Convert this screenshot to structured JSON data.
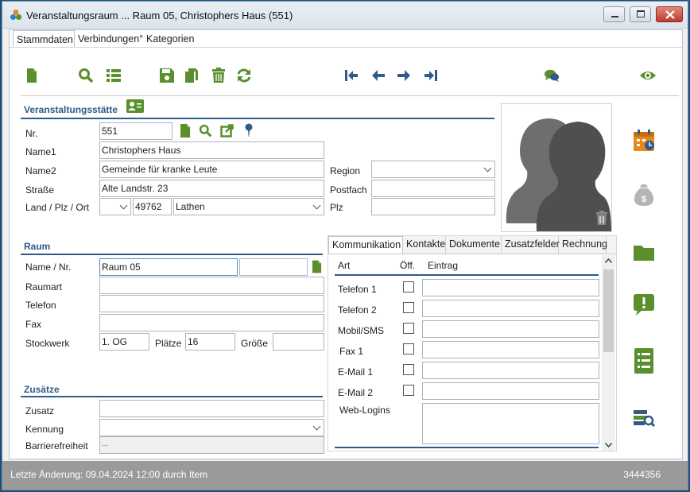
{
  "window": {
    "title": "Veranstaltungsraum ... Raum 05, Christophers Haus (551)"
  },
  "top_tabs": [
    "Stammdaten",
    "Verbindungen°",
    "Kategorien"
  ],
  "toolbar_icons": [
    "new-document-icon",
    "search-icon",
    "list-icon",
    "save-icon",
    "copy-icon",
    "delete-icon",
    "refresh-icon",
    "first-icon",
    "previous-icon",
    "next-icon",
    "last-icon",
    "chat-icon",
    "view-icon"
  ],
  "venue": {
    "section_title": "Veranstaltungsstätte",
    "nr_label": "Nr.",
    "nr_value": "551",
    "name1_label": "Name1",
    "name1_value": "Christophers Haus",
    "name2_label": "Name2",
    "name2_value": "Gemeinde für kranke Leute",
    "street_label": "Straße",
    "street_value": "Alte Landstr. 23",
    "country_label": "Land / Plz / Ort",
    "country_value": "",
    "zip_value": "49762",
    "city_value": "Lathen",
    "region_label": "Region",
    "region_value": "",
    "postfach_label": "Postfach",
    "postfach_value": "",
    "plz_label": "Plz",
    "plz_value": ""
  },
  "room": {
    "section_title": "Raum",
    "name_label": "Name / Nr.",
    "name_value": "Raum 05",
    "nr_value": "",
    "type_label": "Raumart",
    "type_value": "",
    "phone_label": "Telefon",
    "phone_value": "",
    "fax_label": "Fax",
    "fax_value": "",
    "floor_label": "Stockwerk",
    "floor_value": "1. OG",
    "seats_label": "Plätze",
    "seats_value": "16",
    "size_label": "Größe",
    "size_value": ""
  },
  "extras": {
    "section_title": "Zusätze",
    "zusatz_label": "Zusatz",
    "zusatz_value": "",
    "kennung_label": "Kennung",
    "kennung_value": "",
    "barrier_label": "Barrierefreiheit",
    "barrier_value": "..."
  },
  "comm": {
    "tabs": [
      "Kommunikation",
      "Kontakte",
      "Dokumente",
      "Zusatzfelder",
      "Rechnung"
    ],
    "col_art": "Art",
    "col_off": "Öff.",
    "col_entry": "Eintrag",
    "rows": [
      {
        "label": "Telefon 1",
        "value": ""
      },
      {
        "label": "Telefon 2",
        "value": ""
      },
      {
        "label": "Mobil/SMS",
        "value": ""
      },
      {
        "label": "Fax 1",
        "value": ""
      },
      {
        "label": "E-Mail 1",
        "value": ""
      },
      {
        "label": "E-Mail 2",
        "value": ""
      }
    ],
    "weblogins_label": "Web-Logins",
    "weblogins_value": ""
  },
  "side_icons": [
    "calendar-icon",
    "money-bag-icon",
    "folder-icon",
    "alert-message-icon",
    "checklist-icon",
    "search-records-icon"
  ],
  "status": {
    "last_change": "Letzte Änderung: 09.04.2024 12:00 durch Item",
    "record_id": "3444356"
  },
  "colors": {
    "accent_green": "#5a8f2e",
    "accent_blue": "#2f5b8a",
    "orange": "#e8871e"
  }
}
